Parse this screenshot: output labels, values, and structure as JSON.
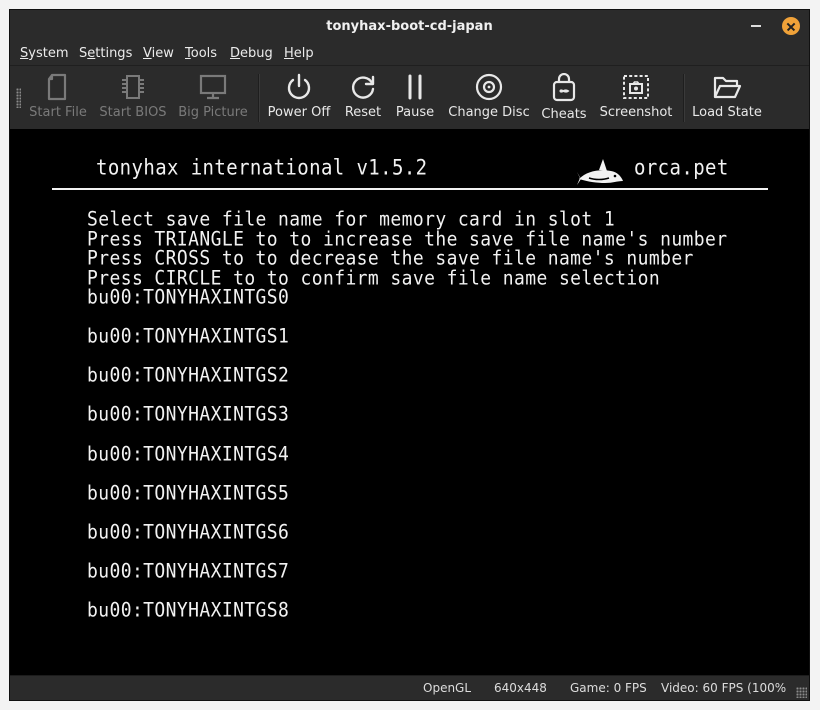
{
  "window": {
    "title": "tonyhax-boot-cd-japan"
  },
  "menu": [
    {
      "label": "System",
      "accel": "S",
      "rest": "ystem"
    },
    {
      "label": "Settings",
      "pre": "S",
      "accel": "e",
      "rest": "ttings"
    },
    {
      "label": "View",
      "accel": "V",
      "rest": "iew"
    },
    {
      "label": "Tools",
      "accel": "T",
      "rest": "ools"
    },
    {
      "label": "Debug",
      "accel": "D",
      "rest": "ebug"
    },
    {
      "label": "Help",
      "accel": "H",
      "rest": "elp"
    }
  ],
  "toolbar": {
    "start_file": "Start File",
    "start_bios": "Start BIOS",
    "big_picture": "Big Picture",
    "power_off": "Power Off",
    "reset": "Reset",
    "pause": "Pause",
    "change_disc": "Change Disc",
    "cheats": "Cheats",
    "screenshot": "Screenshot",
    "load_state": "Load State"
  },
  "game": {
    "header_title": "tonyhax international v1.5.2",
    "header_site": "orca.pet",
    "instructions": [
      "Select save file name for memory card in slot 1",
      "Press TRIANGLE to to increase the save file name's number",
      "Press CROSS to to decrease the save file name's number",
      "Press CIRCLE to to confirm save file name selection"
    ],
    "save_names": [
      "bu00:TONYHAXINTGS0",
      "bu00:TONYHAXINTGS1",
      "bu00:TONYHAXINTGS2",
      "bu00:TONYHAXINTGS3",
      "bu00:TONYHAXINTGS4",
      "bu00:TONYHAXINTGS5",
      "bu00:TONYHAXINTGS6",
      "bu00:TONYHAXINTGS7",
      "bu00:TONYHAXINTGS8"
    ]
  },
  "status": {
    "renderer": "OpenGL",
    "resolution": "640x448",
    "game_fps": "Game: 0 FPS",
    "video_fps": "Video: 60 FPS (100%"
  },
  "colors": {
    "close_button": "#f0a239",
    "chrome": "#2b2b2b",
    "screen": "#000000"
  }
}
